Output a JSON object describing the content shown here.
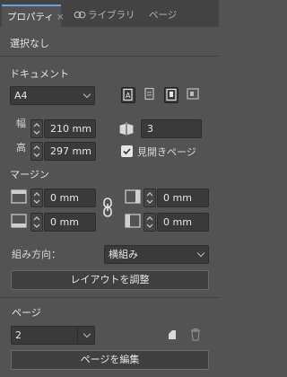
{
  "tabs": [
    {
      "label": "プロパティ",
      "active": true
    },
    {
      "label": "ライブラリ",
      "icon": "cc-libraries-icon"
    },
    {
      "label": "ページ"
    }
  ],
  "selection": {
    "label": "選択なし"
  },
  "document": {
    "section_label": "ドキュメント",
    "page_size": "A4",
    "width_label": "幅",
    "width_value": "210 mm",
    "height_label": "高",
    "height_value": "297 mm",
    "page_count": "3",
    "facing_pages_label": "見開きページ",
    "facing_pages_checked": true
  },
  "margins": {
    "section_label": "マージン",
    "top": "0 mm",
    "bottom": "0 mm",
    "left": "0 mm",
    "right": "0 mm"
  },
  "direction": {
    "label": "組み方向：",
    "value": "横組み"
  },
  "adjust_layout_label": "レイアウトを調整",
  "pages": {
    "section_label": "ページ",
    "current_page": "2",
    "edit_label": "ページを編集"
  },
  "colors": {
    "panel_bg": "#535353",
    "tab_bar_bg": "#434343",
    "accent": "#6f9ddc"
  }
}
